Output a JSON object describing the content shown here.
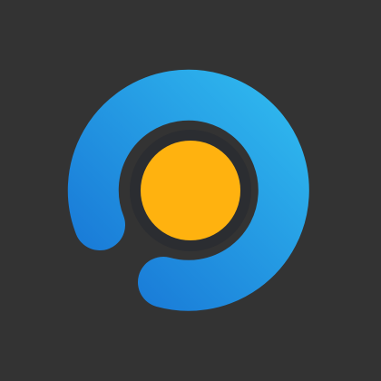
{
  "logo": {
    "icon": "circular-app-logo",
    "colors": {
      "background": "#333333",
      "ring_light": "#2BA9E8",
      "ring_dark": "#1877D6",
      "inner_ring_shadow": "#1D5FA8",
      "center_dot": "#FFB20F",
      "center_dot_ring": "#2B2D31"
    }
  }
}
